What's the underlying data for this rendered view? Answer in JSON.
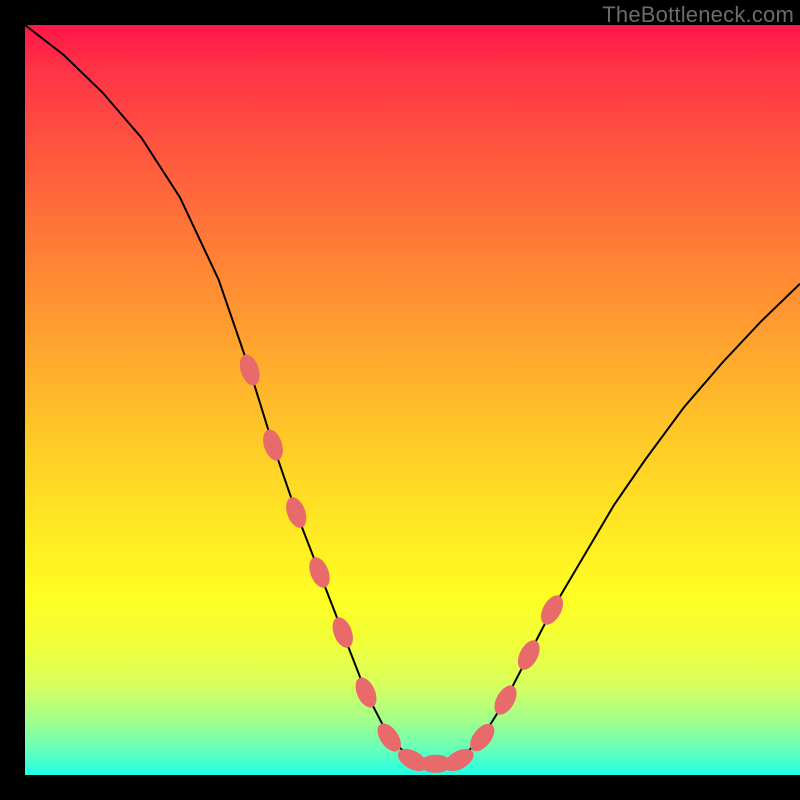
{
  "watermark": "TheBottleneck.com",
  "chart_data": {
    "type": "line",
    "title": "",
    "xlabel": "",
    "ylabel": "",
    "xlim": [
      0,
      1
    ],
    "ylim": [
      0,
      1
    ],
    "note": "No axes or tick labels are visible in the image. x and y are normalized to [0,1] within the plot area (x: left→right, y: bottom→top). The curve depicts a deep V-shaped dip reaching near y≈0 around x≈0.48–0.56 with salmon-colored markers highlighting the points near the minimum on both sides.",
    "series": [
      {
        "name": "curve",
        "x": [
          0.0,
          0.05,
          0.1,
          0.15,
          0.2,
          0.25,
          0.29,
          0.32,
          0.35,
          0.38,
          0.41,
          0.44,
          0.47,
          0.5,
          0.53,
          0.56,
          0.59,
          0.62,
          0.65,
          0.68,
          0.72,
          0.76,
          0.8,
          0.85,
          0.9,
          0.95,
          1.0
        ],
        "y": [
          1.0,
          0.96,
          0.91,
          0.85,
          0.77,
          0.66,
          0.54,
          0.44,
          0.35,
          0.27,
          0.19,
          0.11,
          0.05,
          0.02,
          0.015,
          0.02,
          0.05,
          0.1,
          0.16,
          0.22,
          0.29,
          0.36,
          0.42,
          0.49,
          0.55,
          0.605,
          0.655
        ]
      }
    ],
    "highlighted_points": {
      "name": "near-minimum-markers",
      "x": [
        0.29,
        0.32,
        0.35,
        0.38,
        0.41,
        0.44,
        0.47,
        0.5,
        0.53,
        0.56,
        0.59,
        0.62,
        0.65,
        0.68
      ],
      "y": [
        0.54,
        0.44,
        0.35,
        0.27,
        0.19,
        0.11,
        0.05,
        0.02,
        0.015,
        0.02,
        0.05,
        0.1,
        0.16,
        0.22
      ]
    },
    "colors": {
      "gradient_top": "#ff1648",
      "gradient_bottom": "#1effe7",
      "curve": "#000000",
      "marker": "#e86a6a",
      "frame": "#000000"
    }
  }
}
